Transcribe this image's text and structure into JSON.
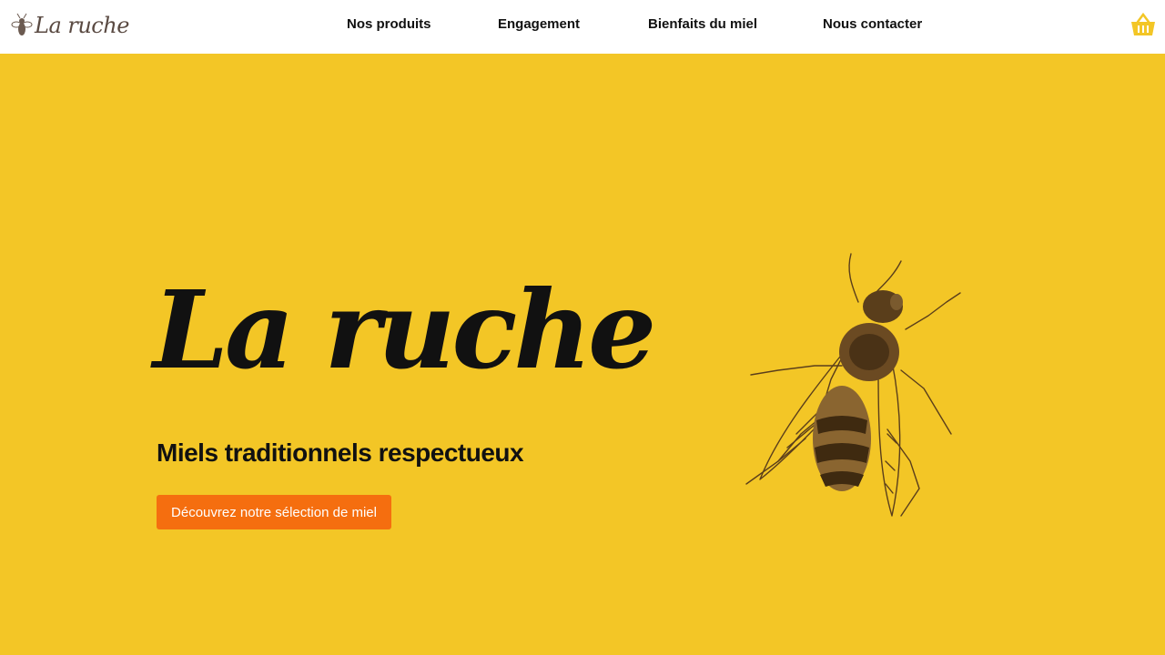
{
  "header": {
    "logo_text": "La ruche",
    "nav": [
      {
        "label": "Nos produits"
      },
      {
        "label": "Engagement"
      },
      {
        "label": "Bienfaits du miel"
      },
      {
        "label": "Nous contacter"
      }
    ],
    "cart_icon": "basket-icon"
  },
  "hero": {
    "title": "La ruche",
    "subtitle": "Miels traditionnels respectueux",
    "cta_label": "Découvrez notre sélection de miel",
    "illustration": "bee-illustration"
  },
  "colors": {
    "hero_background": "#f3c626",
    "header_background": "#ffffff",
    "cta_background": "#f56e0f",
    "cta_text": "#ffffff",
    "cart_icon": "#f3c626",
    "bee_ink": "#5a3e1b"
  }
}
